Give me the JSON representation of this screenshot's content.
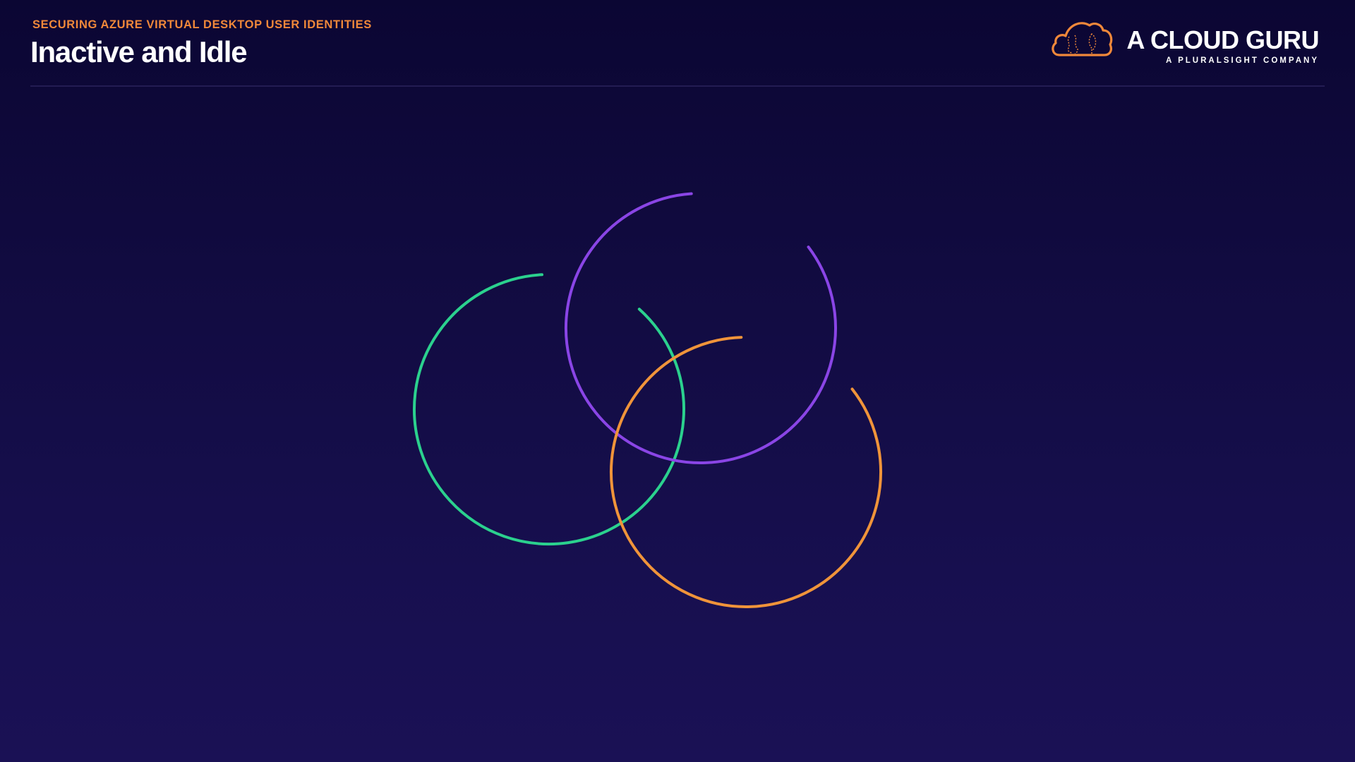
{
  "slide": {
    "course": "SECURING AZURE VIRTUAL DESKTOP USER IDENTITIES",
    "title": "Inactive and Idle"
  },
  "brand": {
    "name": "A CLOUD GURU",
    "tagline": "A PLURALSIGHT COMPANY",
    "logo_icon": "cloud-icon"
  },
  "colors": {
    "background_top": "#0b0633",
    "background_bottom": "#1a1155",
    "accent_orange": "#f0883a",
    "ring_green": "#2bd18e",
    "ring_purple": "#8a45e6",
    "ring_orange": "#f0943a"
  },
  "graphic": {
    "type": "three open circular arcs (decorative)",
    "arcs": [
      "green",
      "purple",
      "orange"
    ]
  }
}
